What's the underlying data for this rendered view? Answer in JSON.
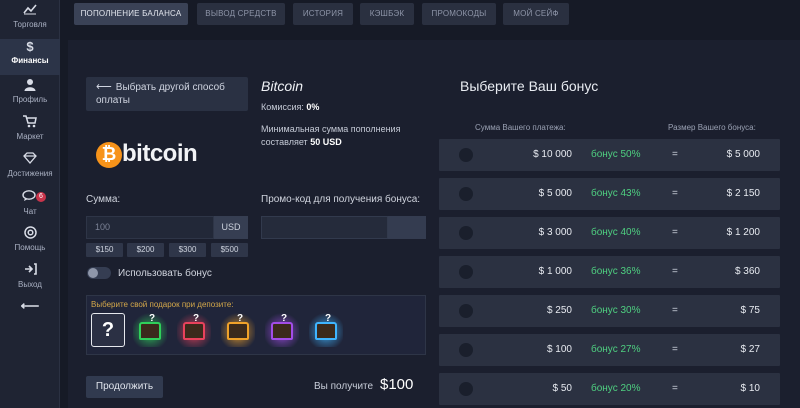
{
  "sidebar": {
    "items": [
      {
        "label": "Торговля",
        "icon": "chart-line-icon",
        "glyph": "⁄⁄"
      },
      {
        "label": "Финансы",
        "icon": "dollar-icon",
        "glyph": "$"
      },
      {
        "label": "Профиль",
        "icon": "user-icon",
        "glyph": "●"
      },
      {
        "label": "Маркет",
        "icon": "cart-icon",
        "glyph": "🛒"
      },
      {
        "label": "Достижения",
        "icon": "diamond-icon",
        "glyph": "◇"
      },
      {
        "label": "Чат",
        "icon": "chat-icon",
        "glyph": "💬"
      },
      {
        "label": "Помощь",
        "icon": "help-icon",
        "glyph": "?"
      },
      {
        "label": "Выход",
        "icon": "exit-icon",
        "glyph": "⇥"
      }
    ],
    "chat_badge": "6",
    "collapse_glyph": "⟵"
  },
  "tabs": [
    {
      "label": "ПОПОЛНЕНИЕ БАЛАНСА"
    },
    {
      "label": "ВЫВОД СРЕДСТВ"
    },
    {
      "label": "ИСТОРИЯ"
    },
    {
      "label": "КЭШБЭК"
    },
    {
      "label": "ПРОМОКОДЫ"
    },
    {
      "label": "МОЙ СЕЙФ"
    }
  ],
  "deposit": {
    "back_arrow": "⟵",
    "back_label": "Выбрать другой способ оплаты",
    "logo_symbol": "₿",
    "logo_text": "bitcoin",
    "method_title": "Bitcoin",
    "commission_label": "Комиссия:",
    "commission_value": "0%",
    "min_label": "Минимальная сумма пополнения составляет",
    "min_value": "50 USD",
    "amount_label": "Сумма:",
    "amount_placeholder": "100",
    "currency": "USD",
    "quick_amounts": [
      "$150",
      "$200",
      "$300",
      "$500"
    ],
    "promo_label": "Промо-код для получения бонуса:",
    "use_bonus_label": "Использовать бонус",
    "use_bonus_on": false,
    "gifts_label": "Выберите свой подарок при депозите:",
    "gift_question": "?",
    "gifts": [
      {
        "name": "green-chest",
        "color": "#2fd05a"
      },
      {
        "name": "red-chest",
        "color": "#e8425c"
      },
      {
        "name": "orange-chest",
        "color": "#f0a22a"
      },
      {
        "name": "purple-chest",
        "color": "#a24de8"
      },
      {
        "name": "blue-chest",
        "color": "#3fb5ff"
      }
    ],
    "continue_label": "Продолжить",
    "receive_label": "Вы получите",
    "receive_value": "$100"
  },
  "bonus": {
    "title": "Выберите Ваш бонус",
    "col_payment": "Сумма Вашего платежа:",
    "col_size": "Размер Вашего бонуса:",
    "rows": [
      {
        "payment": "$ 10 000",
        "percent": "бонус 50%",
        "eq": "=",
        "result": "$ 5 000"
      },
      {
        "payment": "$ 5 000",
        "percent": "бонус 43%",
        "eq": "=",
        "result": "$ 2 150"
      },
      {
        "payment": "$ 3 000",
        "percent": "бонус 40%",
        "eq": "=",
        "result": "$ 1 200"
      },
      {
        "payment": "$ 1 000",
        "percent": "бонус 36%",
        "eq": "=",
        "result": "$ 360"
      },
      {
        "payment": "$ 250",
        "percent": "бонус 30%",
        "eq": "=",
        "result": "$ 75"
      },
      {
        "payment": "$ 100",
        "percent": "бонус 27%",
        "eq": "=",
        "result": "$ 27"
      },
      {
        "payment": "$ 50",
        "percent": "бонус 20%",
        "eq": "=",
        "result": "$ 10"
      }
    ]
  }
}
